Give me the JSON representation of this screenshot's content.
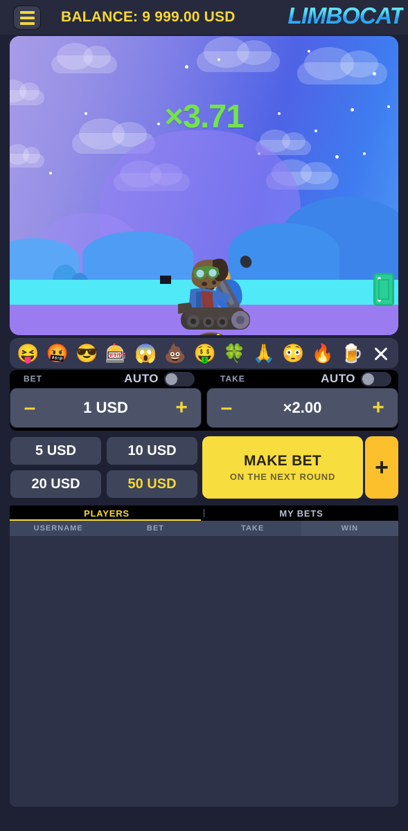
{
  "header": {
    "menu_icon": "hamburger-icon",
    "balance_label": "BALANCE: 9 999.00 USD",
    "logo_text": "LIMBOCAT"
  },
  "game": {
    "multiplier": "×3.71",
    "character": "cat-in-tank",
    "crate": "green-crate"
  },
  "emoji_bar": {
    "emojis": [
      {
        "name": "emoji-squinting-tongue",
        "glyph": "😝"
      },
      {
        "name": "emoji-cursing",
        "glyph": "🤬"
      },
      {
        "name": "emoji-sunglasses",
        "glyph": "😎"
      },
      {
        "name": "emoji-slot-machine",
        "glyph": "🎰"
      },
      {
        "name": "emoji-screaming",
        "glyph": "😱"
      },
      {
        "name": "emoji-poop",
        "glyph": "💩"
      },
      {
        "name": "emoji-money-mouth",
        "glyph": "🤑"
      },
      {
        "name": "emoji-clover",
        "glyph": "🍀"
      },
      {
        "name": "emoji-folded-hands",
        "glyph": "🙏"
      },
      {
        "name": "emoji-flushed",
        "glyph": "😳"
      },
      {
        "name": "emoji-fire",
        "glyph": "🔥"
      },
      {
        "name": "emoji-beer",
        "glyph": "🍺"
      }
    ],
    "close_icon": "close-icon"
  },
  "bet": {
    "label": "BET",
    "auto_label": "AUTO",
    "auto_on": false,
    "minus": "–",
    "plus": "+",
    "value": "1 USD"
  },
  "take": {
    "label": "TAKE",
    "auto_label": "AUTO",
    "auto_on": false,
    "minus": "–",
    "plus": "+",
    "value": "×2.00"
  },
  "quick_bets": [
    {
      "label": "5 USD",
      "active": false
    },
    {
      "label": "10 USD",
      "active": false
    },
    {
      "label": "20 USD",
      "active": false
    },
    {
      "label": "50 USD",
      "active": true
    }
  ],
  "make_bet": {
    "title": "MAKE BET",
    "subtitle": "ON THE NEXT ROUND",
    "add_label": "+"
  },
  "tabs": [
    {
      "label": "PLAYERS",
      "active": true
    },
    {
      "label": "MY BETS",
      "active": false
    }
  ],
  "table": {
    "columns": [
      "USERNAME",
      "BET",
      "TAKE",
      "WIN"
    ],
    "rows": []
  },
  "colors": {
    "page_bg": "#1e2133",
    "panel_bg": "#2e3248",
    "accent_yellow": "#f6d737",
    "accent_gold": "#fbc02b",
    "multiplier_green": "#73e34a",
    "logo_cyan": "#49d5fb"
  }
}
